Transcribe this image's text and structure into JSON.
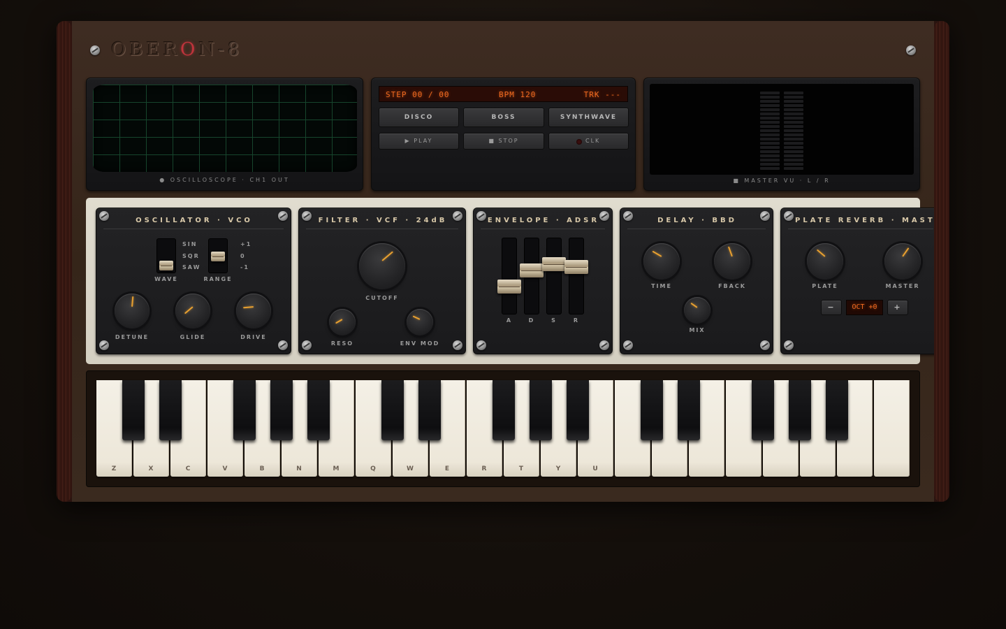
{
  "brand": {
    "logo_prefix": "OBER",
    "logo_accent": "O",
    "logo_suffix": "N",
    "logo_variant": "-8",
    "accent_color": "#c0343c"
  },
  "scope": {
    "caption": "● OSCILLOSCOPE · CH1 OUT",
    "grid_color": "#1e5a3a"
  },
  "sequencer": {
    "step": "STEP 00 / 00",
    "bpm": "BPM 120",
    "track": "TRK ---",
    "presets": [
      {
        "label": "DISCO"
      },
      {
        "label": "BOSS"
      },
      {
        "label": "SYNTHWAVE"
      }
    ],
    "transport": [
      {
        "label": "▶ PLAY"
      },
      {
        "label": "■ STOP"
      },
      {
        "label": "CLK"
      }
    ]
  },
  "vu": {
    "caption": "■ MASTER VU · L / R",
    "segments": 19,
    "level_left": 0,
    "level_right": 0
  },
  "modules": {
    "oscillator": {
      "title": "OSCILLATOR · VCO",
      "wave_switch": {
        "label": "WAVE",
        "options": [
          "SIN",
          "SQR",
          "SAW"
        ],
        "selected": "SAW"
      },
      "range_switch": {
        "label": "RANGE",
        "options": [
          "+1",
          "0",
          "-1"
        ],
        "selected": "0"
      },
      "knobs": [
        {
          "label": "DETUNE",
          "angle": 5
        },
        {
          "label": "GLIDE",
          "angle": -130
        },
        {
          "label": "DRIVE",
          "angle": -95
        }
      ]
    },
    "filter": {
      "title": "FILTER · VCF · 24dB",
      "knobs": [
        {
          "label": "CUTOFF",
          "angle": 50
        },
        {
          "label": "RESO",
          "angle": -120
        },
        {
          "label": "ENV MOD",
          "angle": -65
        }
      ]
    },
    "envelope": {
      "title": "ENVELOPE · ADSR",
      "faders": [
        {
          "label": "A",
          "value": 0.35
        },
        {
          "label": "D",
          "value": 0.6
        },
        {
          "label": "S",
          "value": 0.7
        },
        {
          "label": "R",
          "value": 0.65
        }
      ]
    },
    "delay": {
      "title": "DELAY · BBD",
      "knobs": [
        {
          "label": "TIME",
          "angle": -60
        },
        {
          "label": "FBACK",
          "angle": -20
        },
        {
          "label": "MIX",
          "angle": -55
        }
      ]
    },
    "reverb": {
      "title": "PLATE REVERB · MASTER",
      "knobs": [
        {
          "label": "PLATE",
          "angle": -50
        },
        {
          "label": "MASTER",
          "angle": 35
        }
      ],
      "octave": {
        "display": "OCT +0",
        "minus": "−",
        "plus": "+"
      }
    }
  },
  "keyboard": {
    "white_keys": [
      "Z",
      "X",
      "C",
      "V",
      "B",
      "N",
      "M",
      "Q",
      "W",
      "E",
      "R",
      "T",
      "Y",
      "U",
      "",
      "",
      "",
      "",
      "",
      "",
      "",
      ""
    ]
  }
}
